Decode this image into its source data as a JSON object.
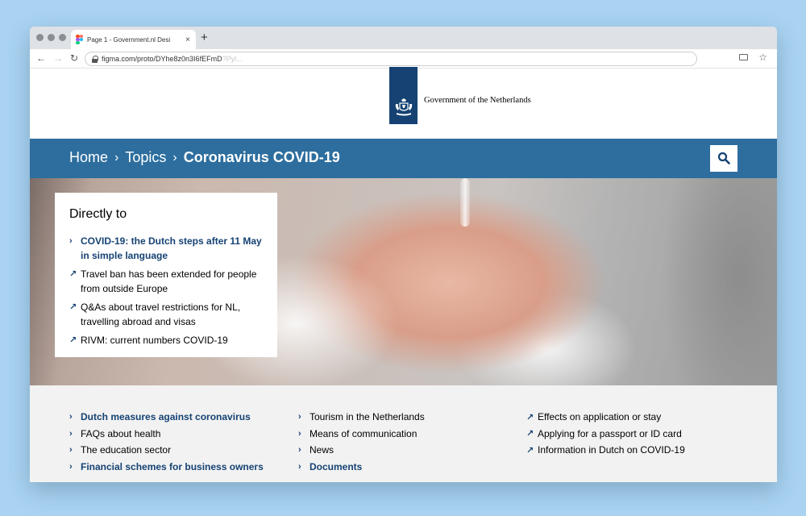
{
  "browser": {
    "tab_title": "Page 1 - Government.nl Desi",
    "tab_close": "×",
    "new_tab": "+",
    "url": "figma.com/proto/DYhe8z0n3I6fEFmD",
    "url_faded": "?Pyl...",
    "back": "←",
    "forward": "→",
    "reload": "↻",
    "star": "☆",
    "figma_colors": [
      "#f24e1e",
      "#ff7262",
      "#a259ff",
      "#1abcfe",
      "#0acf83"
    ]
  },
  "header": {
    "gov_name": "Government of the Netherlands",
    "logo_color": "#154273"
  },
  "nav": {
    "crumbs": [
      "Home",
      "Topics",
      "Coronavirus COVID-19"
    ],
    "separator": "›",
    "bar_color": "#2d6e9e"
  },
  "card": {
    "title": "Directly to",
    "items": [
      {
        "icon": "›",
        "text": "COVID-19: the Dutch steps after 11 May in simple language",
        "style": "link"
      },
      {
        "icon": "↗",
        "text": "Travel ban has been extended for people from outside Europe",
        "style": "plain"
      },
      {
        "icon": "↗",
        "text": "Q&As about travel restrictions for NL, travelling abroad and visas",
        "style": "plain"
      },
      {
        "icon": "↗",
        "text": "RIVM: current numbers COVID-19",
        "style": "plain"
      }
    ]
  },
  "links": {
    "col1": [
      {
        "icon": "›",
        "text": "Dutch measures against coronavirus",
        "style": "link"
      },
      {
        "icon": "›",
        "text": "FAQs about health",
        "style": "plain"
      },
      {
        "icon": "›",
        "text": "The education sector",
        "style": "plain"
      },
      {
        "icon": "›",
        "text": "Financial schemes for business owners",
        "style": "link"
      }
    ],
    "col2": [
      {
        "icon": "›",
        "text": "Tourism in the Netherlands",
        "style": "plain"
      },
      {
        "icon": "›",
        "text": "Means of communication",
        "style": "plain"
      },
      {
        "icon": "›",
        "text": "News",
        "style": "plain"
      },
      {
        "icon": "›",
        "text": "Documents",
        "style": "link"
      }
    ],
    "col3": [
      {
        "icon": "↗",
        "text": "Effects on application or stay",
        "style": "plain"
      },
      {
        "icon": "↗",
        "text": "Applying for a passport or ID card",
        "style": "plain"
      },
      {
        "icon": "↗",
        "text": "Information in Dutch on COVID-19",
        "style": "plain"
      }
    ]
  }
}
